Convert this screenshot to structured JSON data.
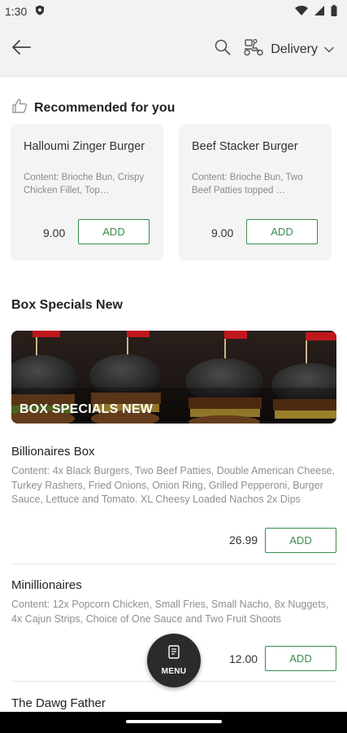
{
  "status_bar": {
    "time": "1:30"
  },
  "top_bar": {
    "delivery_label": "Delivery"
  },
  "recommended": {
    "title": "Recommended for you",
    "items": [
      {
        "name": "Halloumi Zinger Burger",
        "description": "Content: Brioche Bun, Crispy Chicken Fillet, Top…",
        "price": "9.00",
        "add_label": "ADD"
      },
      {
        "name": "Beef Stacker Burger",
        "description": "Content: Brioche Bun, Two Beef Patties topped …",
        "price": "9.00",
        "add_label": "ADD"
      }
    ]
  },
  "section": {
    "title": "Box Specials New",
    "banner_label": "BOX SPECIALS NEW",
    "items": [
      {
        "name": "Billionaires Box",
        "description": "Content: 4x Black Burgers, Two Beef Patties, Double American Cheese, Turkey Rashers, Fried Onions, Onion Ring, Grilled Pepperoni, Burger Sauce, Lettuce and Tomato.   XL Cheesy Loaded Nachos 2x Dips",
        "price": "26.99",
        "add_label": "ADD"
      },
      {
        "name": "Minillionaires",
        "description": "Content: 12x Popcorn Chicken, Small Fries, Small Nacho, 8x Nuggets, 4x Cajun Strips, Choice of One Sauce and Two Fruit Shoots",
        "price": "12.00",
        "add_label": "ADD"
      },
      {
        "name": "The Dawg Father"
      }
    ]
  },
  "fab": {
    "label": "MENU"
  },
  "colors": {
    "accent": "#3a8c4a",
    "header_bg": "#f2f2f2",
    "card_bg": "#f4f4f4",
    "fab_bg": "#2b2b2b"
  }
}
